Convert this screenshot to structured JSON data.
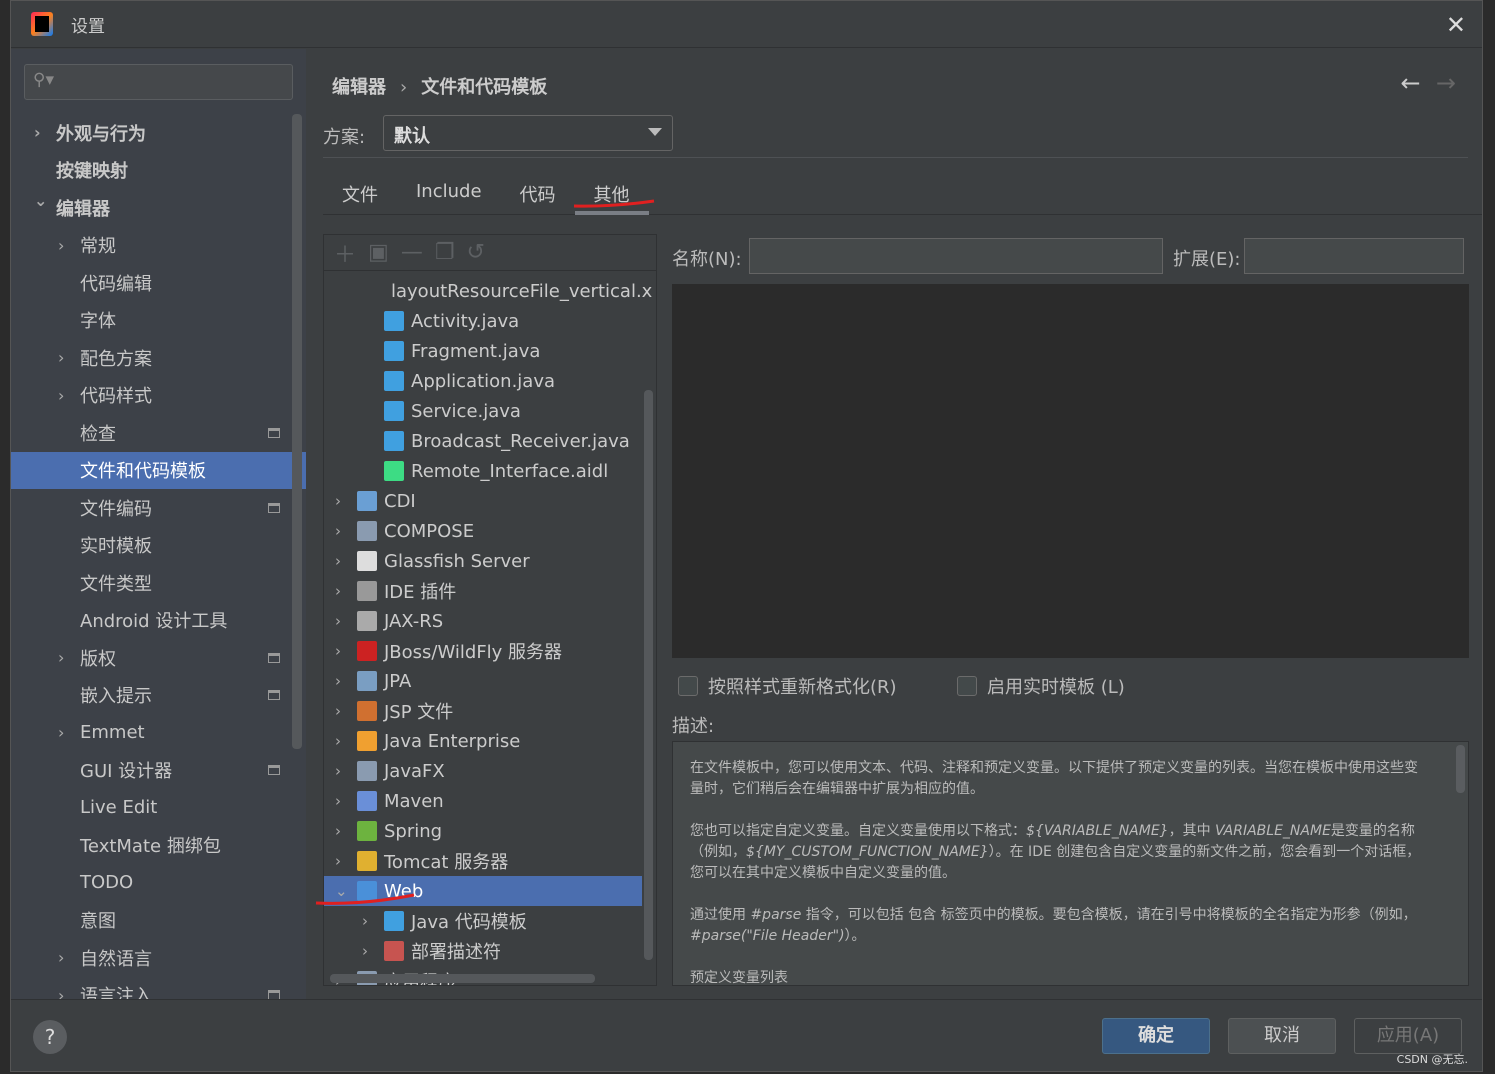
{
  "window": {
    "title": "设置",
    "close_icon": "close-icon"
  },
  "search": {
    "placeholder": ""
  },
  "sidebar": {
    "items": [
      {
        "label": "外观与行为",
        "level": 0,
        "expand": "collapsed",
        "bold": true
      },
      {
        "label": "按键映射",
        "level": 0,
        "bold": true
      },
      {
        "label": "编辑器",
        "level": 0,
        "expand": "expanded",
        "bold": true
      },
      {
        "label": "常规",
        "level": 1,
        "expand": "collapsed"
      },
      {
        "label": "代码编辑",
        "level": 1
      },
      {
        "label": "字体",
        "level": 1
      },
      {
        "label": "配色方案",
        "level": 1,
        "expand": "collapsed"
      },
      {
        "label": "代码样式",
        "level": 1,
        "expand": "collapsed"
      },
      {
        "label": "检查",
        "level": 1,
        "pin": true
      },
      {
        "label": "文件和代码模板",
        "level": 1,
        "selected": true
      },
      {
        "label": "文件编码",
        "level": 1,
        "pin": true
      },
      {
        "label": "实时模板",
        "level": 1
      },
      {
        "label": "文件类型",
        "level": 1
      },
      {
        "label": "Android 设计工具",
        "level": 1
      },
      {
        "label": "版权",
        "level": 1,
        "expand": "collapsed",
        "pin": true
      },
      {
        "label": "嵌入提示",
        "level": 1,
        "pin": true
      },
      {
        "label": "Emmet",
        "level": 1,
        "expand": "collapsed"
      },
      {
        "label": "GUI 设计器",
        "level": 1,
        "pin": true
      },
      {
        "label": "Live Edit",
        "level": 1
      },
      {
        "label": "TextMate 捆绑包",
        "level": 1
      },
      {
        "label": "TODO",
        "level": 1
      },
      {
        "label": "意图",
        "level": 1
      },
      {
        "label": "自然语言",
        "level": 1,
        "expand": "collapsed"
      },
      {
        "label": "语言注入",
        "level": 1,
        "expand": "collapsed",
        "pin": true
      }
    ]
  },
  "breadcrumb": {
    "parent": "编辑器",
    "current": "文件和代码模板"
  },
  "scheme": {
    "label": "方案:",
    "value": "默认"
  },
  "tabs": [
    {
      "label": "文件"
    },
    {
      "label": "Include"
    },
    {
      "label": "代码"
    },
    {
      "label": "其他",
      "active": true
    }
  ],
  "tree": {
    "rows": [
      {
        "label": "layoutResourceFile_vertical.x",
        "level": 2,
        "icon": "xml",
        "color": "#c75450"
      },
      {
        "label": "Activity.java",
        "level": 2,
        "icon": "java",
        "color": "#40a0e0"
      },
      {
        "label": "Fragment.java",
        "level": 2,
        "icon": "java",
        "color": "#40a0e0"
      },
      {
        "label": "Application.java",
        "level": 2,
        "icon": "java",
        "color": "#40a0e0"
      },
      {
        "label": "Service.java",
        "level": 2,
        "icon": "java",
        "color": "#40a0e0"
      },
      {
        "label": "Broadcast_Receiver.java",
        "level": 2,
        "icon": "java",
        "color": "#40a0e0"
      },
      {
        "label": "Remote_Interface.aidl",
        "level": 2,
        "icon": "android",
        "color": "#3ddc84"
      },
      {
        "label": "CDI",
        "level": 1,
        "expand": "collapsed",
        "icon": "cdi",
        "color": "#6a9fd4"
      },
      {
        "label": "COMPOSE",
        "level": 1,
        "expand": "collapsed",
        "icon": "folder",
        "color": "#8a9bb0"
      },
      {
        "label": "Glassfish Server",
        "level": 1,
        "expand": "collapsed",
        "icon": "fish",
        "color": "#dddddd"
      },
      {
        "label": "IDE 插件",
        "level": 1,
        "expand": "collapsed",
        "icon": "plugin",
        "color": "#999999"
      },
      {
        "label": "JAX-RS",
        "level": 1,
        "expand": "collapsed",
        "icon": "globe",
        "color": "#aaaaaa"
      },
      {
        "label": "JBoss/WildFly 服务器",
        "level": 1,
        "expand": "collapsed",
        "icon": "jboss",
        "color": "#cc2222"
      },
      {
        "label": "JPA",
        "level": 1,
        "expand": "collapsed",
        "icon": "jpa",
        "color": "#7a9ec2"
      },
      {
        "label": "JSP 文件",
        "level": 1,
        "expand": "collapsed",
        "icon": "jsp",
        "color": "#d07030"
      },
      {
        "label": "Java Enterprise",
        "level": 1,
        "expand": "collapsed",
        "icon": "javaee",
        "color": "#f0a030"
      },
      {
        "label": "JavaFX",
        "level": 1,
        "expand": "collapsed",
        "icon": "folder",
        "color": "#8a9bb0"
      },
      {
        "label": "Maven",
        "level": 1,
        "expand": "collapsed",
        "icon": "maven",
        "color": "#6a8fd8"
      },
      {
        "label": "Spring",
        "level": 1,
        "expand": "collapsed",
        "icon": "spring",
        "color": "#6db33f"
      },
      {
        "label": "Tomcat 服务器",
        "level": 1,
        "expand": "collapsed",
        "icon": "tomcat",
        "color": "#e0b030"
      },
      {
        "label": "Web",
        "level": 1,
        "expand": "expanded",
        "icon": "web",
        "color": "#4a90d9",
        "selected": true
      },
      {
        "label": "Java 代码模板",
        "level": 2,
        "expand": "collapsed",
        "icon": "java",
        "color": "#40a0e0"
      },
      {
        "label": "部署描述符",
        "level": 2,
        "expand": "collapsed",
        "icon": "xml",
        "color": "#c75450"
      },
      {
        "label": "应用程序",
        "level": 1,
        "expand": "collapsed",
        "icon": "folder",
        "color": "#8a9bb0"
      }
    ]
  },
  "form": {
    "name_label": "名称(N):",
    "name_value": "",
    "ext_label": "扩展(E):",
    "ext_value": "",
    "reformat_label": "按照样式重新格式化(R)",
    "reformat_checked": false,
    "live_label": "启用实时模板 (L)",
    "live_checked": false,
    "desc_label": "描述:"
  },
  "description": {
    "p1": "在文件模板中，您可以使用文本、代码、注释和预定义变量。以下提供了预定义变量的列表。当您在模板中使用这些变量时，它们稍后会在编辑器中扩展为相应的值。",
    "p2a": "您也可以指定自定义变量。自定义变量使用以下格式：",
    "p2v1": "${VARIABLE_NAME}",
    "p2b": "，其中 ",
    "p2v2": "VARIABLE_NAME",
    "p2c": "是变量的名称（例如，",
    "p2v3": "${MY_CUSTOM_FUNCTION_NAME}",
    "p2d": "）。在 IDE 创建包含自定义变量的新文件之前，您会看到一个对话框，您可以在其中定义模板中自定义变量的值。",
    "p3a": "通过使用 ",
    "p3v1": "#parse",
    "p3b": " 指令，可以包括 包含 标签页中的模板。要包含模板，请在引号中将模板的全名指定为形参（例如，",
    "p3v2": "#parse(\"File Header\")",
    "p3c": "）。",
    "p4": "预定义变量列表"
  },
  "footer": {
    "help": "?",
    "ok": "确定",
    "cancel": "取消",
    "apply": "应用(A)",
    "watermark": "CSDN @无忘."
  },
  "colors": {
    "accent": "#4b6eaf",
    "primary_button": "#365880",
    "annotation": "#e02020"
  }
}
